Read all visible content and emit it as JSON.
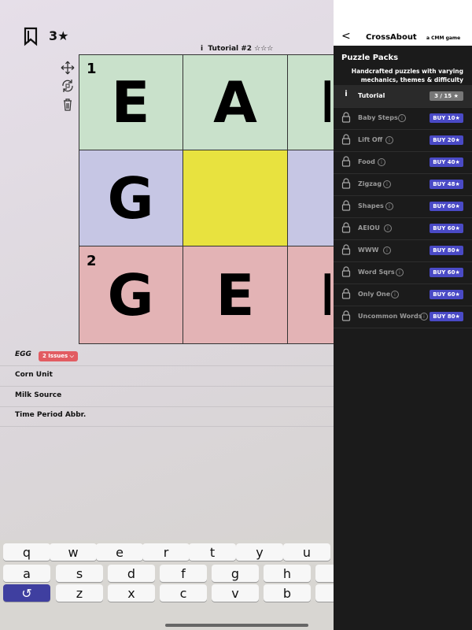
{
  "header": {
    "stars": "3★"
  },
  "puzzle": {
    "info_glyph": "i",
    "title": "Tutorial #2 ☆☆☆"
  },
  "grid": {
    "cells": [
      {
        "letter": "E",
        "number": "1"
      },
      {
        "letter": "A",
        "number": ""
      },
      {
        "letter": "G",
        "number": ""
      },
      {
        "letter": "",
        "number": ""
      },
      {
        "letter": "G",
        "number": "2"
      },
      {
        "letter": "E",
        "number": ""
      }
    ],
    "colors": {
      "green": "#c9e1cb",
      "purple": "#c6c6e4",
      "yellow": "#e8e23f",
      "red": "#e3b3b5"
    }
  },
  "clues": {
    "current": "EGG",
    "issues": "2 Issues ⌵",
    "items": [
      "Corn Unit",
      "Milk Source",
      "Time Period Abbr."
    ]
  },
  "keyboard": {
    "row1": [
      "q",
      "w",
      "e",
      "r",
      "t",
      "y",
      "u"
    ],
    "row2": [
      "a",
      "s",
      "d",
      "f",
      "g",
      "h"
    ],
    "row3": [
      "↺",
      "z",
      "x",
      "c",
      "v",
      "b"
    ]
  },
  "panel": {
    "back": "<",
    "title": "CrossAbout",
    "subtitle": "a CMM game",
    "packs_title": "Puzzle Packs",
    "packs_desc": "Handcrafted puzzles with varying mechanics, themes & difficulty",
    "packs": [
      {
        "name": "Tutorial",
        "badge": "3 / 15 ★",
        "owned": true
      },
      {
        "name": "Baby Steps",
        "badge": "BUY 10★",
        "owned": false
      },
      {
        "name": "Lift Off",
        "badge": "BUY 20★",
        "owned": false
      },
      {
        "name": "Food",
        "badge": "BUY 40★",
        "owned": false
      },
      {
        "name": "Zigzag",
        "badge": "BUY 48★",
        "owned": false
      },
      {
        "name": "Shapes",
        "badge": "BUY 60★",
        "owned": false
      },
      {
        "name": "AEIOU",
        "badge": "BUY 60★",
        "owned": false
      },
      {
        "name": "WWW",
        "badge": "BUY 80★",
        "owned": false
      },
      {
        "name": "Word Sqrs",
        "badge": "BUY 60★",
        "owned": false
      },
      {
        "name": "Only One",
        "badge": "BUY 60★",
        "owned": false
      },
      {
        "name": "Uncommon Words",
        "badge": "BUY 80★",
        "owned": false
      }
    ]
  }
}
